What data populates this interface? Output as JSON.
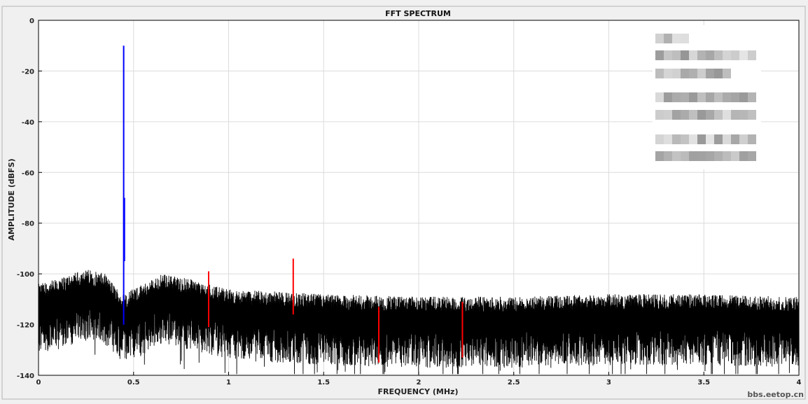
{
  "chart_data": {
    "type": "line",
    "title": "FFT SPECTRUM",
    "xlabel": "FREQUENCY (MHz)",
    "ylabel": "AMPLITUDE (dBFS)",
    "xlim": [
      0,
      4
    ],
    "ylim": [
      -140,
      0
    ],
    "xticks": [
      "0",
      "0.5",
      "1",
      "1.5",
      "2",
      "2.5",
      "3",
      "3.5",
      "4"
    ],
    "xtick_values": [
      0,
      0.5,
      1,
      1.5,
      2,
      2.5,
      3,
      3.5,
      4
    ],
    "yticks": [
      "0",
      "-20",
      "-40",
      "-60",
      "-80",
      "-100",
      "-120",
      "-140"
    ],
    "ytick_values": [
      0,
      -20,
      -40,
      -60,
      -80,
      -100,
      -120,
      -140
    ],
    "grid": true,
    "legend": "top-right (obscured)",
    "series": [
      {
        "color": "#000000",
        "noise_floor_dbfs": -113,
        "noise_envelope": [
          {
            "x": 0.0,
            "y": -108
          },
          {
            "x": 0.1,
            "y": -106
          },
          {
            "x": 0.25,
            "y": -102
          },
          {
            "x": 0.35,
            "y": -104
          },
          {
            "x": 0.44,
            "y": -112
          },
          {
            "x": 0.55,
            "y": -108
          },
          {
            "x": 0.65,
            "y": -104
          },
          {
            "x": 0.8,
            "y": -106
          },
          {
            "x": 1.0,
            "y": -110
          },
          {
            "x": 1.5,
            "y": -112
          },
          {
            "x": 2.0,
            "y": -113
          },
          {
            "x": 2.5,
            "y": -113
          },
          {
            "x": 3.0,
            "y": -112
          },
          {
            "x": 3.5,
            "y": -112
          },
          {
            "x": 4.0,
            "y": -113
          }
        ]
      },
      {
        "color": "#0000ff",
        "peaks": [
          {
            "x": 0.448,
            "y": -10
          }
        ]
      },
      {
        "color": "#ff0000",
        "peaks": [
          {
            "x": 0.895,
            "y": -99
          },
          {
            "x": 1.34,
            "y": -94
          },
          {
            "x": 1.79,
            "y": -113
          },
          {
            "x": 2.23,
            "y": -111
          }
        ]
      }
    ]
  },
  "watermark": "bbs.eetop.cn",
  "colors": {
    "background": "#f0f0f0",
    "plot_area": "#ffffff",
    "grid": "#dcdcdc",
    "noise": "#000000",
    "fundamental": "#0000ff",
    "harmonics": "#ff0000"
  }
}
